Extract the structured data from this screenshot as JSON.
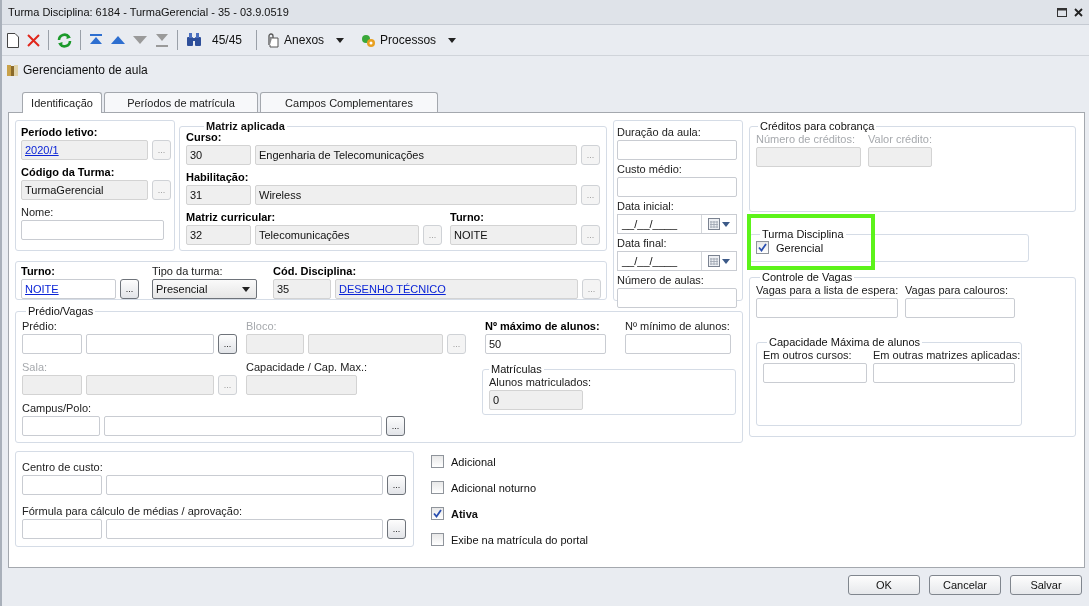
{
  "window": {
    "title": "Turma Disciplina: 6184 - TurmaGerencial - 35 - 03.9.0519"
  },
  "toolbar": {
    "record_counter": "45/45",
    "menus": [
      {
        "label": "Anexos",
        "kind": "attachments"
      },
      {
        "label": "Processos",
        "kind": "processes"
      }
    ]
  },
  "breadcrumb": "Gerenciamento de aula",
  "tabs": [
    {
      "label": "Identificação",
      "selected": true
    },
    {
      "label": "Períodos de matrícula",
      "selected": false
    },
    {
      "label": "Campos Complementares",
      "selected": false
    }
  ],
  "turma_box": {
    "fields": [
      {
        "kind": "lookup",
        "label": "Período letivo:",
        "required": true,
        "value": "2020/1",
        "link": true,
        "readonly": true,
        "button": "...",
        "button_active": false
      },
      {
        "kind": "lookup",
        "label": "Código da Turma:",
        "required": true,
        "value": "TurmaGerencial",
        "readonly": true,
        "button": "...",
        "button_active": false
      },
      {
        "kind": "text",
        "label": "Nome:"
      }
    ]
  },
  "matriz_aplicada": {
    "title": "Matriz aplicada",
    "fields": [
      {
        "kind": "code_lookup",
        "label": "Curso:",
        "required": true,
        "code": "30",
        "description": "Engenharia de Telecomunicações",
        "readonly": true,
        "button": "...",
        "button_active": false
      },
      {
        "kind": "code_lookup",
        "label": "Habilitação:",
        "required": true,
        "code": "31",
        "description": "Wireless",
        "readonly": true,
        "button": "...",
        "button_active": false
      },
      {
        "kind": "code_lookup",
        "label": "Matriz curricular:",
        "required": true,
        "code": "32",
        "description": "Telecomunicações",
        "readonly": true,
        "button": "...",
        "button_active": false
      },
      {
        "kind": "lookup",
        "label": "Turno:",
        "required": true,
        "value": "NOITE",
        "readonly": true,
        "button": "...",
        "button_active": false
      }
    ]
  },
  "disciplina_row": {
    "fields": [
      {
        "kind": "lookup",
        "label": "Turno:",
        "required": true,
        "value": "NOITE",
        "link": true,
        "button": "...",
        "button_active": true
      },
      {
        "kind": "select",
        "label": "Tipo da turma:",
        "value": "Presencial"
      },
      {
        "kind": "code_lookup",
        "label": "Cód. Disciplina:",
        "required": true,
        "code": "35",
        "description": "DESENHO TÉCNICO",
        "link": true,
        "readonly": true,
        "button": "...",
        "button_active": false
      }
    ]
  },
  "aula": {
    "fields": [
      {
        "kind": "text",
        "label": "Duração da aula:"
      },
      {
        "kind": "text",
        "label": "Custo médio:"
      },
      {
        "kind": "date",
        "label": "Data inicial:",
        "value": "__/__/____"
      },
      {
        "kind": "date",
        "label": "Data final:",
        "value": "__/__/____"
      },
      {
        "kind": "text",
        "label": "Número de aulas:"
      }
    ]
  },
  "predio_vagas": {
    "title": "Prédio/Vagas",
    "fields": [
      {
        "kind": "code_lookup",
        "label": "Prédio:",
        "button": "...",
        "button_active": true
      },
      {
        "kind": "code_lookup",
        "label": "Bloco:",
        "disabled": true,
        "readonly": true,
        "button": "...",
        "button_active": false
      },
      {
        "kind": "code_lookup",
        "label": "Sala:",
        "disabled": true,
        "readonly": true,
        "button": "...",
        "button_active": false
      },
      {
        "kind": "text",
        "label": "Capacidade / Cap. Max.:",
        "readonly": true
      },
      {
        "kind": "code_lookup",
        "label": "Campus/Polo:",
        "button": "...",
        "button_active": true
      },
      {
        "kind": "text",
        "label": "Nº máximo de alunos:",
        "required": true,
        "value": "50"
      },
      {
        "kind": "text",
        "label": "Nº mínimo de alunos:"
      }
    ],
    "matriculas": {
      "title": "Matrículas",
      "fields": [
        {
          "kind": "text",
          "label": "Alunos matriculados:",
          "value": "0",
          "readonly": true
        }
      ]
    }
  },
  "custos": {
    "fields": [
      {
        "kind": "code_lookup",
        "label": "Centro de custo:",
        "button": "...",
        "button_active": true
      },
      {
        "kind": "code_lookup",
        "label": "Fórmula para cálculo de médias / aprovação:",
        "button": "...",
        "button_active": true
      }
    ]
  },
  "options": [
    {
      "label": "Adicional",
      "checked": false,
      "strong": false
    },
    {
      "label": "Adicional noturno",
      "checked": false,
      "strong": false
    },
    {
      "label": "Ativa",
      "checked": true,
      "strong": true
    },
    {
      "label": "Exibe na matrícula do portal",
      "checked": false,
      "strong": false
    }
  ],
  "creditos": {
    "title": "Créditos para cobrança",
    "fields": [
      {
        "kind": "text",
        "label": "Número de créditos:",
        "disabled": true,
        "readonly": true
      },
      {
        "kind": "text",
        "label": "Valor crédito:",
        "disabled": true,
        "readonly": true
      }
    ]
  },
  "turma_disciplina": {
    "title": "Turma Disciplina",
    "highlighted": true,
    "options": [
      {
        "label": "Gerencial",
        "checked": true
      }
    ]
  },
  "controle_vagas": {
    "title": "Controle de Vagas",
    "fields": [
      {
        "kind": "text",
        "label": "Vagas para a lista de espera:"
      },
      {
        "kind": "text",
        "label": "Vagas para calouros:"
      }
    ],
    "capacidade": {
      "title": "Capacidade Máxima de alunos",
      "fields": [
        {
          "kind": "text",
          "label": "Em outros cursos:"
        },
        {
          "kind": "text",
          "label": "Em outras matrizes aplicadas:"
        }
      ]
    }
  },
  "buttons": [
    {
      "label": "OK"
    },
    {
      "label": "Cancelar"
    },
    {
      "label": "Salvar"
    }
  ]
}
